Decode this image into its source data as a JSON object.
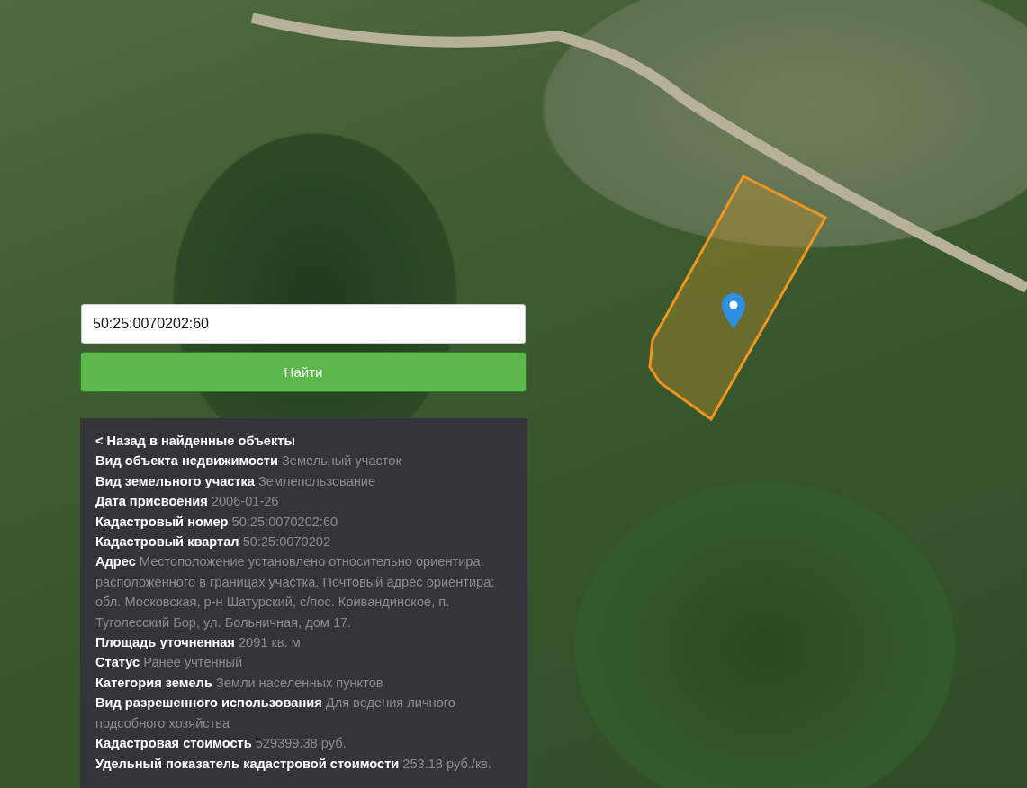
{
  "search": {
    "value": "50:25:0070202:60"
  },
  "find_button": {
    "label": "Найти"
  },
  "info_panel": {
    "back_link": "< Назад в найденные объекты",
    "fields": [
      {
        "label": "Вид объекта недвижимости",
        "value": "Земельный участок"
      },
      {
        "label": "Вид земельного участка",
        "value": "Землепользование"
      },
      {
        "label": "Дата присвоения",
        "value": "2006-01-26"
      },
      {
        "label": "Кадастровый номер",
        "value": "50:25:0070202:60"
      },
      {
        "label": "Кадастровый квартал",
        "value": "50:25:0070202"
      },
      {
        "label": "Адрес",
        "value": "Местоположение установлено относительно ориентира, расположенного в границах участка. Почтовый адрес ориентира: обл. Московская, р-н Шатурский, с/пос. Кривандинское, п. Туголесский Бор, ул. Больничная, дом 17."
      },
      {
        "label": "Площадь уточненная",
        "value": "2091 кв. м"
      },
      {
        "label": "Статус",
        "value": "Ранее учтенный"
      },
      {
        "label": "Категория земель",
        "value": "Земли населенных пунктов"
      },
      {
        "label": "Вид разрешенного использования",
        "value": "Для ведения личного подсобного хозяйства"
      },
      {
        "label": "Кадастровая стоимость",
        "value": "529399.38 руб."
      },
      {
        "label": "Удельный показатель кадастровой стоимости",
        "value": "253.18 руб./кв."
      }
    ]
  }
}
